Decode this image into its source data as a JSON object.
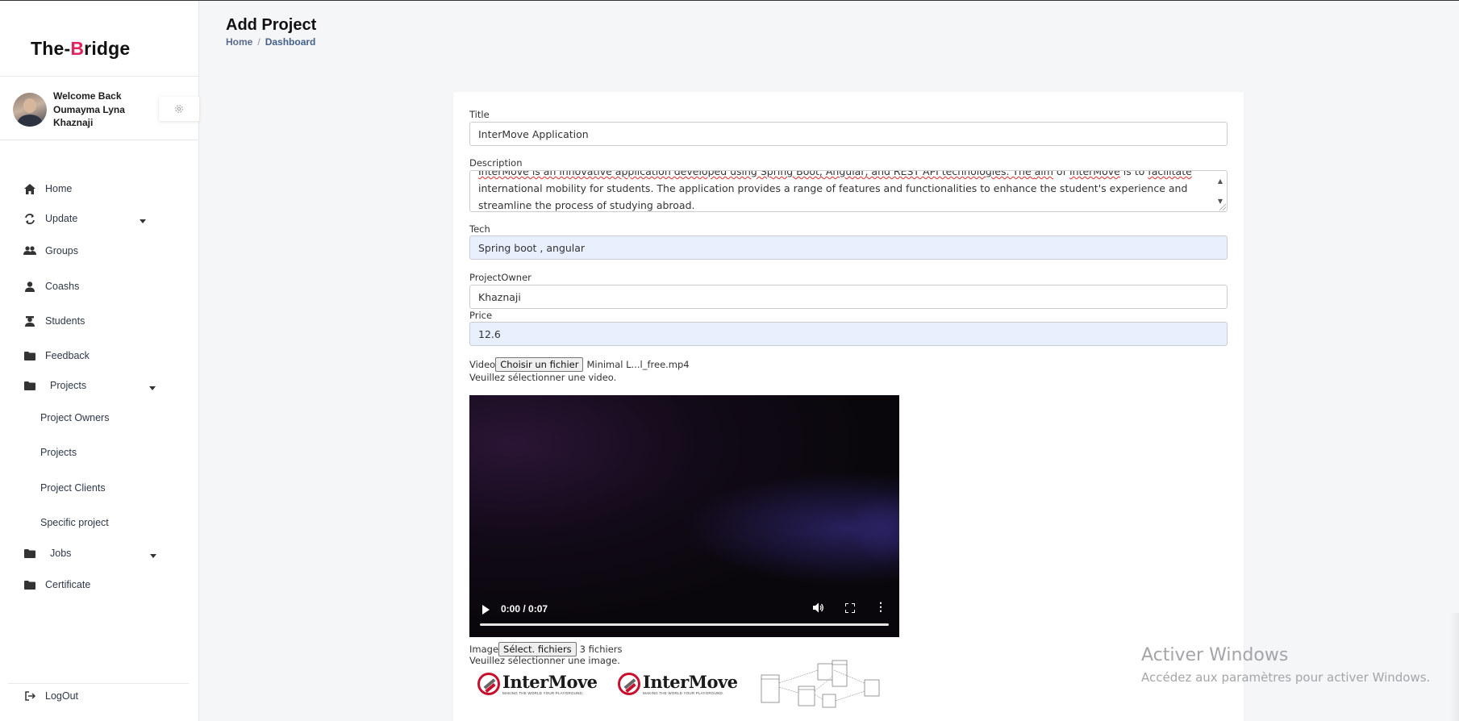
{
  "app": {
    "logo_prefix": "The-",
    "logo_accent": "B",
    "logo_suffix": "ridge",
    "accent_color": "#e0245e"
  },
  "user": {
    "welcome": "Welcome Back Oumayma Lyna Khaznaji"
  },
  "sidebar": {
    "items": [
      {
        "label": "Home",
        "icon": "home-icon"
      },
      {
        "label": "Update",
        "icon": "refresh-icon"
      },
      {
        "label": "Groups",
        "icon": "groups-icon"
      },
      {
        "label": "Coashs",
        "icon": "person-icon"
      },
      {
        "label": "Students",
        "icon": "student-icon"
      },
      {
        "label": "Feedback",
        "icon": "folder-icon"
      },
      {
        "label": "Projects",
        "icon": "folder-icon"
      },
      {
        "label": "Jobs",
        "icon": "folder-icon"
      },
      {
        "label": "Certificate",
        "icon": "folder-icon"
      }
    ],
    "project_subitems": [
      {
        "label": "Project Owners"
      },
      {
        "label": "Projects"
      },
      {
        "label": "Project Clients"
      },
      {
        "label": "Specific project"
      }
    ],
    "logout": "LogOut"
  },
  "header": {
    "title": "Add Project",
    "breadcrumb": {
      "home": "Home",
      "separator": "/",
      "current": "Dashboard"
    }
  },
  "form": {
    "title_label": "Title",
    "title_value": "InterMove Application",
    "description_label": "Description",
    "description_line1_a": "InterMove is an innovative application developed using Spring Boot, Angular, and REST API technologies. The ",
    "description_line1_b": "aim",
    "description_line1_c": " of ",
    "description_line1_d": "InterMove",
    "description_line1_e": " is to ",
    "description_line1_f": "facilitate",
    "description_line2": "international mobility for students. The application provides a range of features and functionalities to enhance the student's experience and",
    "description_line3": "streamline the process of studying abroad.",
    "tech_label": "Tech",
    "tech_value": "Spring boot , angular",
    "owner_label": "ProjectOwner",
    "owner_value": "Khaznaji",
    "price_label": "Price",
    "price_value": "12.6",
    "video_label": "Video",
    "video_button": "Choisir un fichier",
    "video_file": "Minimal L...l_free.mp4",
    "video_hint": "Veuillez sélectionner une video.",
    "video_time": "0:00 / 0:07",
    "video_progress": 0,
    "image_label": "Image",
    "image_button": "Sélect. fichiers",
    "image_count": "3 fichiers",
    "image_hint": "Veuillez sélectionner une image.",
    "thumb_brand": "InterMove",
    "thumb_tagline": "MAKING THE WORLD YOUR PLAYGROUND."
  },
  "watermark": {
    "line1": "Activer Windows",
    "line2": "Accédez aux paramètres pour activer Windows."
  }
}
